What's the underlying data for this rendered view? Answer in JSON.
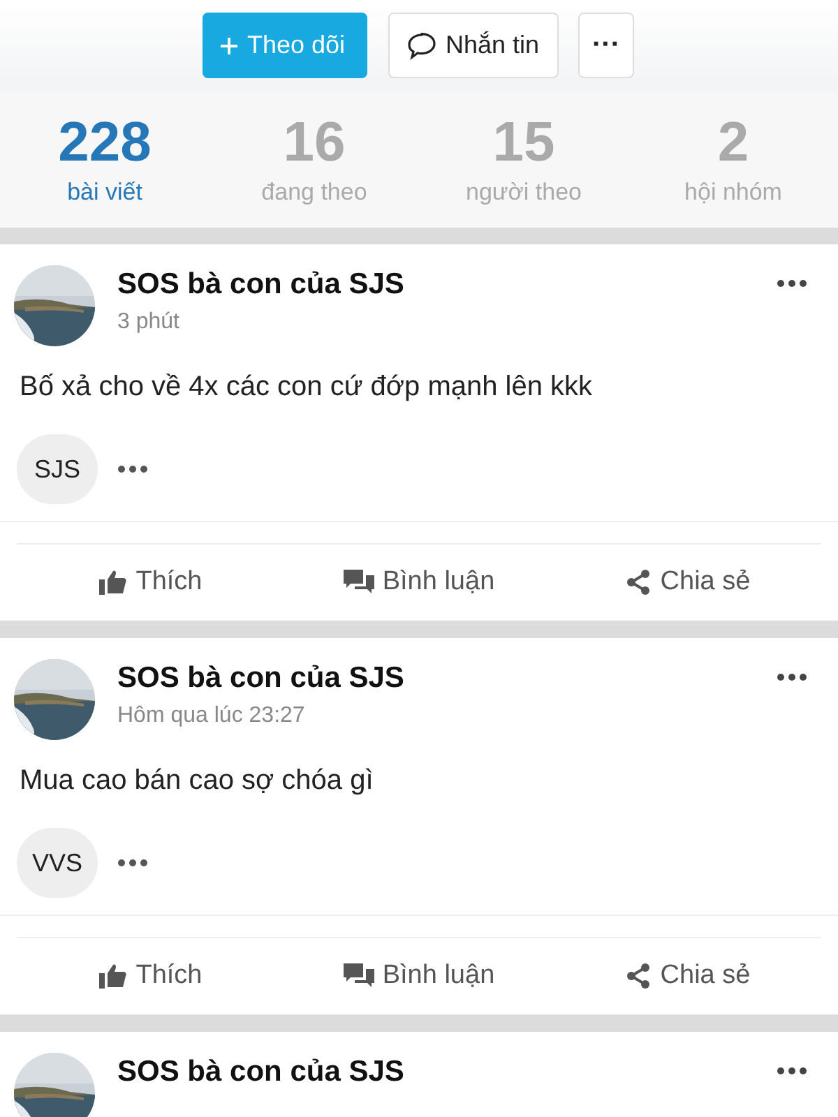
{
  "actions": {
    "follow": "Theo dõi",
    "message": "Nhắn tin",
    "more": "···"
  },
  "stats": [
    {
      "count": "228",
      "label": "bài viết",
      "selected": true
    },
    {
      "count": "16",
      "label": "đang theo",
      "selected": false
    },
    {
      "count": "15",
      "label": "người theo",
      "selected": false
    },
    {
      "count": "2",
      "label": "hội nhóm",
      "selected": false
    }
  ],
  "posts": [
    {
      "author": "SOS bà con của SJS",
      "time": "3 phút",
      "text": "Bố xả cho về 4x các con cứ đớp mạnh lên kkk",
      "tag": "SJS",
      "buttons": [
        "Thích",
        "Bình luận",
        "Chia sẻ"
      ]
    },
    {
      "author": "SOS bà con của SJS",
      "time": "Hôm qua lúc 23:27",
      "text": "Mua cao bán cao sợ chóa gì",
      "tag": "VVS",
      "buttons": [
        "Thích",
        "Bình luận",
        "Chia sẻ"
      ]
    },
    {
      "author": "SOS bà con của SJS"
    }
  ]
}
